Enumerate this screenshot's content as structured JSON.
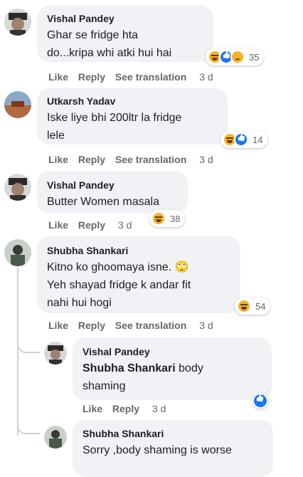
{
  "actions": {
    "like": "Like",
    "reply": "Reply",
    "see_translation": "See translation"
  },
  "comments": [
    {
      "author": "Vishal Pandey",
      "lines": [
        "Ghar se fridge hta",
        "do...kripa whi atki hui hai"
      ],
      "time": "3 d",
      "reactions": [
        "haha",
        "like",
        "sad"
      ],
      "count": "35"
    },
    {
      "author": "Utkarsh Yadav",
      "lines": [
        "Iske liye bhi 200ltr la fridge",
        "lele"
      ],
      "time": "3 d",
      "reactions": [
        "haha",
        "like"
      ],
      "count": "14"
    },
    {
      "author": "Vishal Pandey",
      "lines": [
        "Butter Women masala"
      ],
      "time": "3 d",
      "reactions": [
        "haha"
      ],
      "count": "38"
    },
    {
      "author": "Shubha Shankari",
      "lines": [
        "Kitno ko ghoomaya isne. 🙄",
        "Yeh shayad fridge k andar fit",
        "nahi hui hogi"
      ],
      "time": "3 d",
      "reactions": [
        "haha"
      ],
      "count": "54"
    },
    {
      "author": "Vishal Pandey",
      "mention": "Shubha Shankari",
      "lines": [
        " body",
        "shaming"
      ],
      "time": "3 d",
      "reactions": [
        "like"
      ],
      "count": ""
    },
    {
      "author": "Shubha Shankari",
      "lines": [
        "Sorry ,body shaming is worse"
      ]
    }
  ],
  "colors": {
    "bubble": "#f0f2f5",
    "meta": "#65676b",
    "text": "#1c1e21",
    "like_blue": "#1877f2",
    "haha_yellow": "#f7b125"
  }
}
